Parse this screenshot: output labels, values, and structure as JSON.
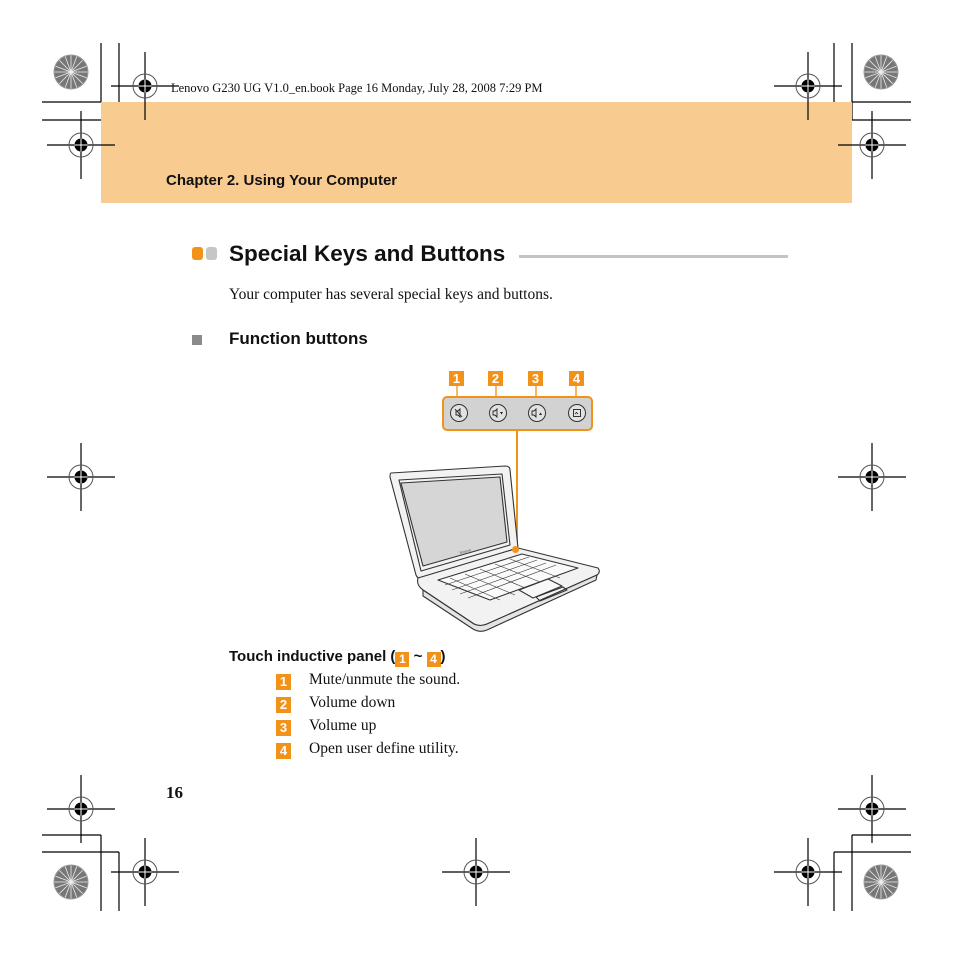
{
  "header": {
    "book_meta": "Lenovo G230 UG V1.0_en.book  Page 16  Monday, July 28, 2008  7:29 PM",
    "chapter_title": "Chapter 2. Using Your Computer",
    "band_color": "#f8cb90"
  },
  "section": {
    "title": "Special Keys and Buttons",
    "intro": "Your computer has several special keys and buttons."
  },
  "subsection": {
    "title": "Function buttons"
  },
  "figure": {
    "tags": [
      "1",
      "2",
      "3",
      "4"
    ],
    "buttons": [
      {
        "icon": "mute-icon",
        "glyph": "🔇"
      },
      {
        "icon": "volume-down-icon",
        "glyph": "◁▾"
      },
      {
        "icon": "volume-up-icon",
        "glyph": "◁▴"
      },
      {
        "icon": "user-utility-icon",
        "glyph": "⊡"
      }
    ],
    "laptop_brand": "lenovo",
    "accent_color": "#f39219"
  },
  "panel_label": {
    "prefix": "Touch inductive panel (",
    "from": "1",
    "separator": " ~ ",
    "to": "4",
    "suffix": ")"
  },
  "list": [
    {
      "num": "1",
      "text": "Mute/unmute the sound."
    },
    {
      "num": "2",
      "text": "Volume down"
    },
    {
      "num": "3",
      "text": "Volume up"
    },
    {
      "num": "4",
      "text": "Open user define utility."
    }
  ],
  "page_number": "16"
}
